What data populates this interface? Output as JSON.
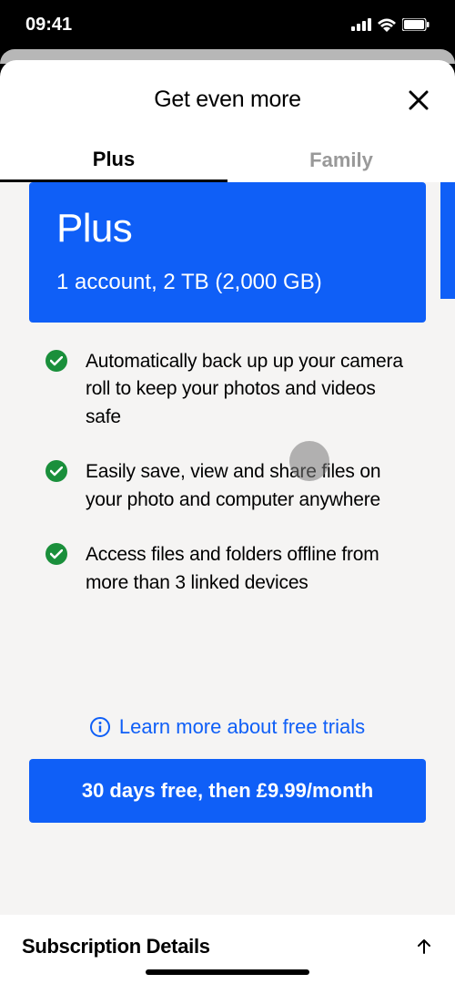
{
  "status": {
    "time": "09:41"
  },
  "header": {
    "title": "Get even more"
  },
  "tabs": {
    "plus": "Plus",
    "family": "Family"
  },
  "plan": {
    "name": "Plus",
    "sub": "1 account, 2 TB (2,000 GB)"
  },
  "features": [
    "Automatically back up up your camera roll to keep your photos and videos safe",
    "Easily save, view and share files on your photo and computer anywhere",
    "Access files and folders offline from more than 3 linked devices"
  ],
  "learn_more": "Learn more about free trials",
  "cta": "30 days free, then £9.99/month",
  "details": "Subscription Details"
}
